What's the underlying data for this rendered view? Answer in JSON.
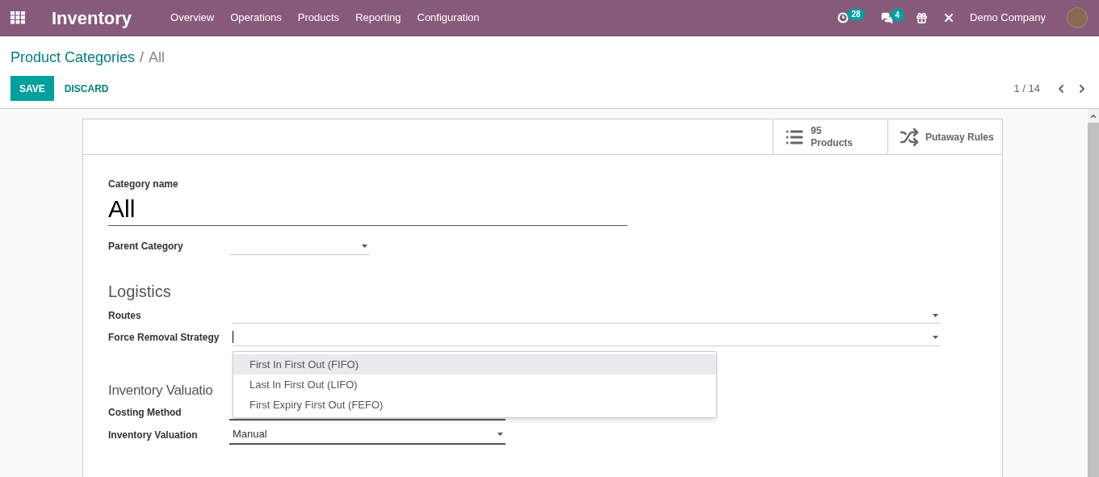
{
  "navbar": {
    "app_name": "Inventory",
    "menu": [
      "Overview",
      "Operations",
      "Products",
      "Reporting",
      "Configuration"
    ],
    "activity_count": "28",
    "message_count": "4",
    "company": "Demo Company"
  },
  "breadcrumb": {
    "parent": "Product Categories",
    "separator": "/",
    "current": "All"
  },
  "buttons": {
    "save": "SAVE",
    "discard": "DISCARD"
  },
  "pager": {
    "value": "1 / 14"
  },
  "smart_buttons": [
    {
      "kind": "count",
      "value": "95",
      "label": "Products"
    },
    {
      "kind": "plain",
      "label": "Putaway Rules"
    }
  ],
  "form": {
    "name_label": "Category name",
    "name_value": "All",
    "parent_label": "Parent Category",
    "logistics_heading": "Logistics",
    "routes_label": "Routes",
    "removal_label": "Force Removal Strategy",
    "valuation_heading": "Inventory Valuatio",
    "costing_label": "Costing Method",
    "valuation_label": "Inventory Valuation",
    "valuation_value": "Manual"
  },
  "dropdown": {
    "options": [
      {
        "label": "First In First Out (FIFO)",
        "selected": true
      },
      {
        "label": "Last In First Out (LIFO)",
        "selected": false
      },
      {
        "label": "First Expiry First Out (FEFO)",
        "selected": false
      }
    ]
  }
}
